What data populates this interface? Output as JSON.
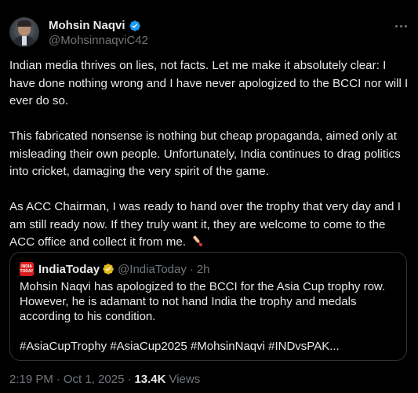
{
  "author": {
    "name": "Mohsin Naqvi",
    "handle": "@MohsinnaqviC42"
  },
  "tweet": {
    "paragraphs": [
      "Indian media thrives on lies, not facts. Let me make it absolutely clear: I have done nothing wrong and I have never apologized to the BCCI nor will I ever do so.",
      "This fabricated nonsense is nothing but cheap propaganda, aimed only at misleading their own people. Unfortunately, India continues to drag politics into cricket, damaging the very spirit of the game.",
      "As ACC Chairman, I was ready to hand over the trophy that very day and I am still ready now. If they truly want it, they are welcome to come to the ACC office and collect it from me."
    ],
    "emoji": "cricket-bat-icon"
  },
  "quoted": {
    "name": "IndiaToday",
    "handle": "@IndiaToday",
    "separator": "·",
    "time": "2h",
    "text": "Mohsin Naqvi has apologized to the BCCI for the Asia Cup trophy row. However, he is adamant to not hand India the trophy and medals according to his condition.",
    "hashtags": "#AsiaCupTrophy #AsiaCup2025 #MohsinNaqvi #INDvsPAK...",
    "logo_text": [
      "INDIA",
      "TODAY"
    ]
  },
  "footer": {
    "time": "2:19 PM",
    "date": "Oct 1, 2025",
    "separator": "·",
    "views_count": "13.4K",
    "views_label": "Views"
  },
  "colors": {
    "background": "#000000",
    "text": "#e7e9ea",
    "muted": "#71767b",
    "verified_blue": "#1d9bf0",
    "verified_gold": "#e2b719",
    "border": "#2f3336"
  }
}
